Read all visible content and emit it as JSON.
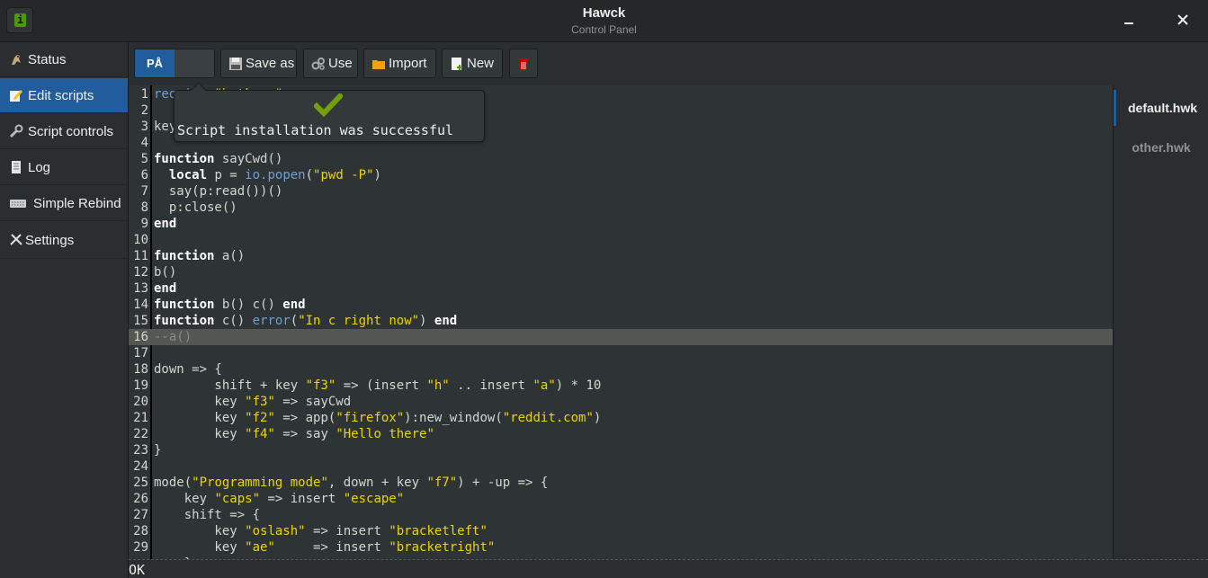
{
  "window": {
    "title": "Hawck",
    "subtitle": "Control Panel",
    "info_icon": "i"
  },
  "sidebar": {
    "items": [
      {
        "label": "Status",
        "icon": "eagle-icon"
      },
      {
        "label": "Edit scripts",
        "icon": "edit-icon"
      },
      {
        "label": "Script controls",
        "icon": "wrench-icon"
      },
      {
        "label": "Log",
        "icon": "scroll-icon"
      },
      {
        "label": "Simple Rebind",
        "icon": "keyboard-icon"
      },
      {
        "label": "Settings",
        "icon": "tools-icon"
      }
    ],
    "selected": "Edit scripts"
  },
  "toolbar": {
    "toggle_label": "PÅ",
    "save_as_label": "Save as",
    "use_label": "Use",
    "import_label": "Import",
    "new_label": "New",
    "delete_icon": "trash-icon"
  },
  "popover": {
    "message": "Script installation was successful",
    "icon": "checkmark-icon"
  },
  "editor": {
    "current_line": 16,
    "lines": [
      "require \"hotkeys\"",
      "",
      "key\"f1\" => say \"hi\"",
      "",
      "function sayCwd()",
      "  local p = io.popen(\"pwd -P\")",
      "  say(p:read())()",
      "  p:close()",
      "end",
      "",
      "function a()",
      "b()",
      "end",
      "function b() c() end",
      "function c() error(\"In c right now\") end",
      "--a()",
      "",
      "down => {",
      "        shift + key \"f3\" => (insert \"h\" .. insert \"a\") * 10",
      "        key \"f3\" => sayCwd",
      "        key \"f2\" => app(\"firefox\"):new_window(\"reddit.com\")",
      "        key \"f4\" => say \"Hello there\"",
      "}",
      "",
      "mode(\"Programming mode\", down + key \"f7\") + -up => {",
      "    key \"caps\" => insert \"escape\"",
      "    shift => {",
      "        key \"oslash\" => insert \"bracketleft\"",
      "        key \"ae\"     => insert \"bracketright\"",
      "    }"
    ],
    "line_numbers": [
      "1",
      "2",
      "3",
      "4",
      "5",
      "6",
      "7",
      "8",
      "9",
      "10",
      "11",
      "12",
      "13",
      "14",
      "15",
      "16",
      "17",
      "18",
      "19",
      "20",
      "21",
      "22",
      "23",
      "24",
      "25",
      "26",
      "27",
      "28",
      "29"
    ]
  },
  "files": [
    {
      "name": "default.hwk",
      "selected": true
    },
    {
      "name": "other.hwk",
      "selected": false
    }
  ],
  "status": {
    "text": "OK"
  },
  "colors": {
    "accent": "#215d9c",
    "string": "#edd400",
    "builtin": "#729fcf",
    "success": "#73a00a",
    "danger": "#cc0000"
  }
}
